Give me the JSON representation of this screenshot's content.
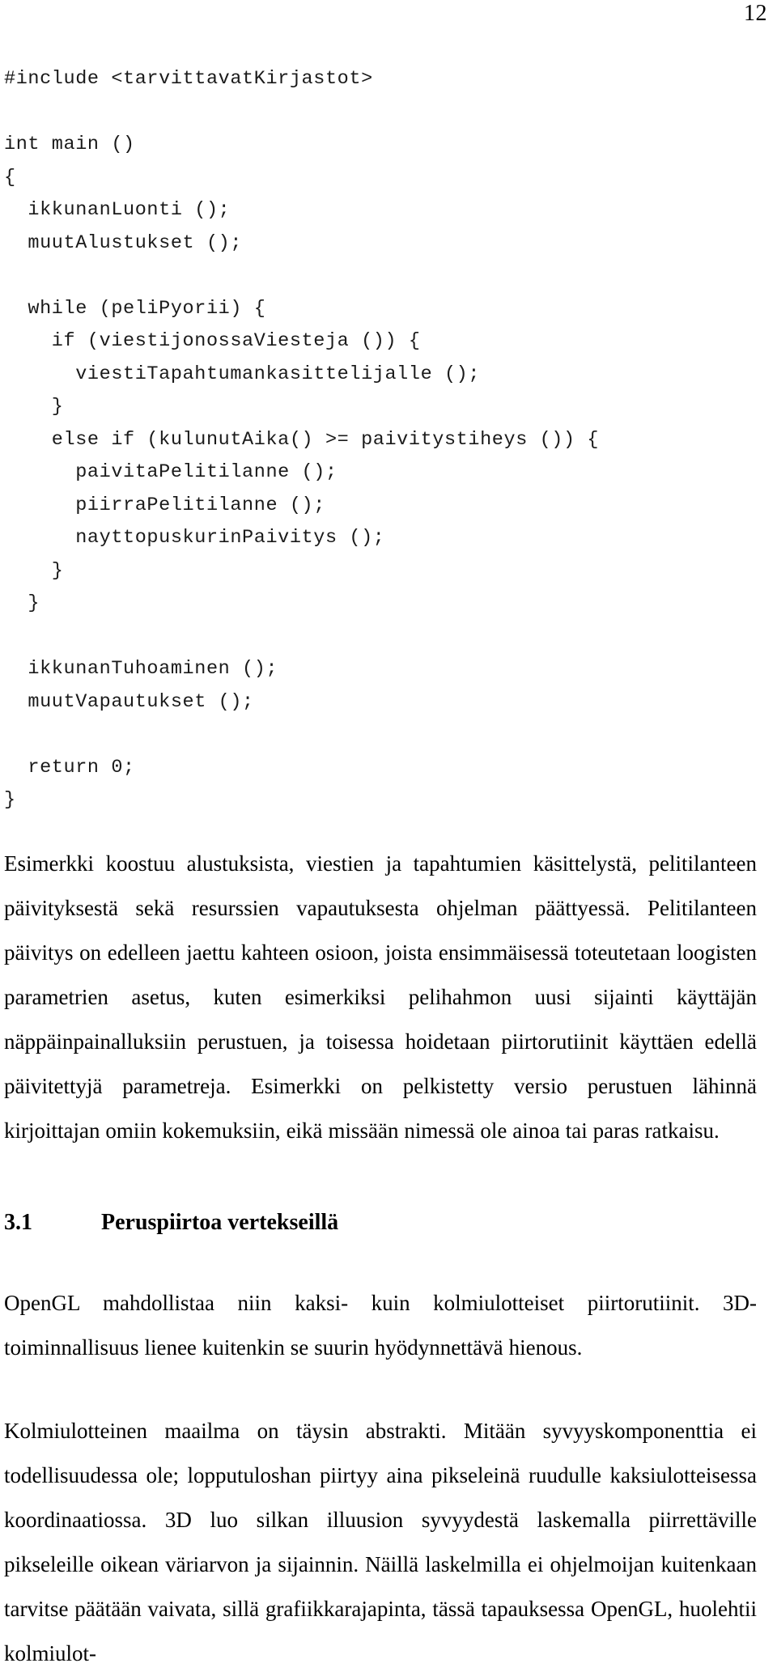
{
  "page": {
    "number": "12"
  },
  "code_listing": {
    "name": "c-pseudocode-main-loop",
    "lines": [
      "#include <tarvittavatKirjastot>",
      "",
      "int main ()",
      "{",
      "  ikkunanLuonti ();",
      "  muutAlustukset ();",
      "",
      "  while (peliPyorii) {",
      "    if (viestijonossaViesteja ()) {",
      "      viestiTapahtumankasittelijalle ();",
      "    }",
      "    else if (kulunutAika() >= paivitystiheys ()) {",
      "      paivitaPelitilanne ();",
      "      piirraPelitilanne ();",
      "      nayttopuskurinPaivitys ();",
      "    }",
      "  }",
      "",
      "  ikkunanTuhoaminen ();",
      "  muutVapautukset ();",
      "",
      "  return 0;",
      "}"
    ]
  },
  "paragraphs": {
    "intro": "Esimerkki koostuu alustuksista, viestien ja tapahtumien käsittelystä, pelitilanteen päivityksestä sekä resurssien vapautuksesta ohjelman päättyessä. Pelitilanteen päivitys on edelleen jaettu kahteen osioon, joista ensimmäisessä toteutetaan loogisten parametrien asetus, kuten esimerkiksi pelihahmon uusi sijainti käyttäjän näppäinpainalluksiin perustuen, ja toisessa hoidetaan piirtorutiinit käyttäen edellä päivitettyjä parametreja. Esimerkki on pelkistetty versio perustuen lähinnä kirjoittajan omiin kokemuksiin, eikä missään nimessä ole ainoa tai paras ratkaisu.",
    "opengl": "OpenGL mahdollistaa niin kaksi- kuin kolmiulotteiset piirtorutiinit. 3D-toiminnallisuus lienee kuitenkin se suurin hyödynnettävä hienous.",
    "kolmiulotteinen": "Kolmiulotteinen maailma on täysin abstrakti. Mitään syvyyskomponenttia ei todellisuudessa ole; lopputuloshan piirtyy aina pikseleinä ruudulle kaksiulotteisessa koordinaatiossa. 3D luo silkan illuusion syvyydestä laskemalla piirrettäville pikseleille oikean väriarvon ja sijainnin. Näillä laskelmilla ei ohjelmoijan kuitenkaan tarvitse päätään vaivata, sillä grafiikkarajapinta, tässä tapauksessa OpenGL, huolehtii kolmiulot-"
  },
  "section_heading": {
    "number": "3.1",
    "title": "Peruspiirtoa vertekseillä"
  }
}
